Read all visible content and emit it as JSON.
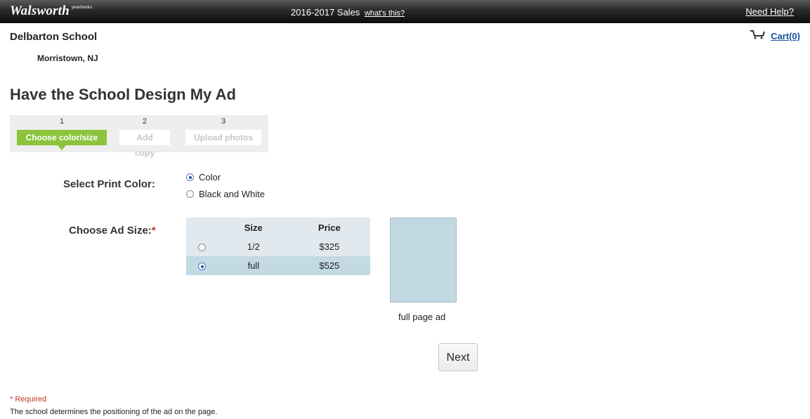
{
  "header": {
    "logo_text": "Walsworth",
    "logo_sup": "yearbooks",
    "season": "2016-2017 Sales",
    "whats_this": "what's this?",
    "need_help": "Need Help?"
  },
  "school": {
    "name": "Delbarton School",
    "location": "Morristown, NJ"
  },
  "cart": {
    "icon": "cart-icon",
    "label": "Cart(0)"
  },
  "page": {
    "title": "Have the School Design My Ad"
  },
  "steps": [
    {
      "number": "1",
      "label": "Choose color/size",
      "active": true
    },
    {
      "number": "2",
      "label": "Add copy",
      "active": false
    },
    {
      "number": "3",
      "label": "Upload photos",
      "active": false
    }
  ],
  "print_color": {
    "label": "Select Print Color:",
    "options": [
      {
        "label": "Color",
        "selected": true
      },
      {
        "label": "Black and White",
        "selected": false
      }
    ]
  },
  "ad_size": {
    "label": "Choose Ad Size:",
    "required_mark": "*",
    "columns": [
      "Size",
      "Price"
    ],
    "rows": [
      {
        "size": "1/2",
        "price": "$325",
        "selected": false
      },
      {
        "size": "full",
        "price": "$525",
        "selected": true
      }
    ]
  },
  "preview": {
    "caption": "full page ad"
  },
  "actions": {
    "next": "Next"
  },
  "footer": {
    "required_note": "* Required",
    "positioning_note": "The school determines the positioning of the ad on the page."
  },
  "colors": {
    "accent_green": "#8cc43c",
    "link_blue": "#1a4f9c",
    "required_red": "#c0392b",
    "table_row_selected": "#c3d9e4"
  }
}
